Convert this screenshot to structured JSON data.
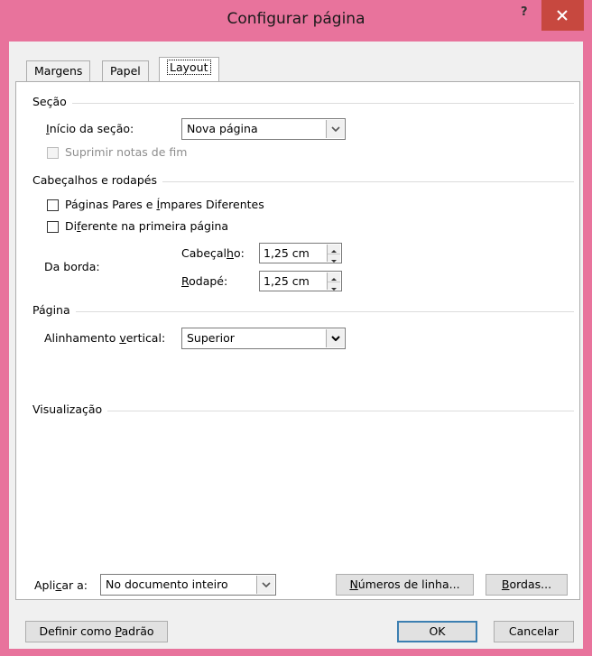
{
  "window": {
    "title": "Configurar página",
    "help_label": "?",
    "close_icon": "close-icon"
  },
  "tabs": [
    {
      "label": "Margens",
      "active": false
    },
    {
      "label": "Papel",
      "active": false
    },
    {
      "label": "Layout",
      "active": true
    }
  ],
  "secao": {
    "group_label": "Seção",
    "inicio_label_pre": "I",
    "inicio_label_rest": "nício da seção:",
    "inicio_value": "Nova página",
    "suprimir_label": "Suprimir notas de fim",
    "suprimir_checked": false,
    "suprimir_enabled": false
  },
  "cabecalhos": {
    "group_label": "Cabeçalhos e rodapés",
    "pares_label_pre": "Páginas Pares e ",
    "pares_label_u": "Í",
    "pares_label_post": "mpares Diferentes",
    "pares_checked": false,
    "primeira_label_pre": "Di",
    "primeira_label_u": "f",
    "primeira_label_post": "erente na primeira página",
    "primeira_checked": false,
    "da_borda_label": "Da borda:",
    "cabecalho_label_pre": "Cabeçal",
    "cabecalho_label_u": "h",
    "cabecalho_label_post": "o:",
    "cabecalho_value": "1,25 cm",
    "rodape_label_u": "R",
    "rodape_label_post": "odapé:",
    "rodape_value": "1,25 cm"
  },
  "pagina": {
    "group_label": "Página",
    "alinhamento_label_pre": "Alinhamento ",
    "alinhamento_label_u": "v",
    "alinhamento_label_post": "ertical:",
    "alinhamento_value": "Superior"
  },
  "visualizacao": {
    "group_label": "Visualização"
  },
  "aplicar": {
    "label_pre": "Apli",
    "label_u": "c",
    "label_post": "ar a:",
    "value": "No documento inteiro"
  },
  "buttons": {
    "numeros_u": "N",
    "numeros_rest": "úmeros de linha...",
    "bordas_u": "B",
    "bordas_rest": "ordas...",
    "padrao_pre": "Definir como ",
    "padrao_u": "P",
    "padrao_post": "adrão",
    "ok": "OK",
    "cancelar": "Cancelar"
  },
  "colors": {
    "titlebar": "#e8739c",
    "close_button": "#c7483f",
    "dialog_bg": "#f0f0f0",
    "panel_bg": "#ffffff"
  }
}
